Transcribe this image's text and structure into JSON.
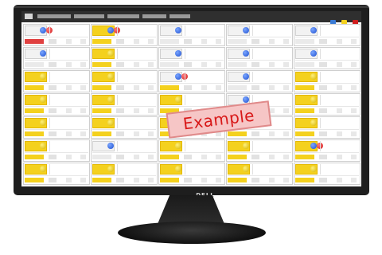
{
  "brand": {
    "label": "DELL"
  },
  "watermark": {
    "text": "Example"
  },
  "toolbar": {
    "legend_colors": [
      "#3a7bd5",
      "#f4d11e",
      "#d01e1e"
    ]
  },
  "tiles": [
    {
      "tag_yellow": false,
      "balls": [
        "blue",
        "red"
      ],
      "first_color": "r"
    },
    {
      "tag_yellow": true,
      "balls": [
        "blue",
        "red"
      ],
      "first_color": "y"
    },
    {
      "tag_yellow": false,
      "balls": [
        "blue"
      ],
      "first_color": ""
    },
    {
      "tag_yellow": false,
      "balls": [
        "blue"
      ],
      "first_color": ""
    },
    {
      "tag_yellow": false,
      "balls": [
        "blue"
      ],
      "first_color": ""
    },
    {
      "tag_yellow": false,
      "balls": [
        "blue"
      ],
      "first_color": ""
    },
    {
      "tag_yellow": true,
      "balls": [
        "yellow"
      ],
      "first_color": "y"
    },
    {
      "tag_yellow": false,
      "balls": [
        "blue"
      ],
      "first_color": ""
    },
    {
      "tag_yellow": false,
      "balls": [
        "blue"
      ],
      "first_color": ""
    },
    {
      "tag_yellow": false,
      "balls": [
        "blue"
      ],
      "first_color": ""
    },
    {
      "tag_yellow": true,
      "balls": [
        "yellow"
      ],
      "first_color": "y"
    },
    {
      "tag_yellow": true,
      "balls": [
        "yellow"
      ],
      "first_color": "y"
    },
    {
      "tag_yellow": false,
      "balls": [
        "blue",
        "red"
      ],
      "first_color": "y"
    },
    {
      "tag_yellow": false,
      "balls": [
        "blue"
      ],
      "first_color": ""
    },
    {
      "tag_yellow": true,
      "balls": [
        "yellow"
      ],
      "first_color": "y"
    },
    {
      "tag_yellow": true,
      "balls": [
        "yellow"
      ],
      "first_color": "y"
    },
    {
      "tag_yellow": true,
      "balls": [
        "yellow"
      ],
      "first_color": "y"
    },
    {
      "tag_yellow": true,
      "balls": [
        "yellow"
      ],
      "first_color": "y"
    },
    {
      "tag_yellow": false,
      "balls": [
        "blue"
      ],
      "first_color": ""
    },
    {
      "tag_yellow": true,
      "balls": [
        "yellow"
      ],
      "first_color": "y"
    },
    {
      "tag_yellow": true,
      "balls": [
        "yellow"
      ],
      "first_color": "y"
    },
    {
      "tag_yellow": true,
      "balls": [
        "yellow"
      ],
      "first_color": "y"
    },
    {
      "tag_yellow": true,
      "balls": [
        "yellow"
      ],
      "first_color": "y"
    },
    {
      "tag_yellow": true,
      "balls": [
        "yellow"
      ],
      "first_color": "y"
    },
    {
      "tag_yellow": true,
      "balls": [
        "yellow"
      ],
      "first_color": "y"
    },
    {
      "tag_yellow": true,
      "balls": [
        "yellow"
      ],
      "first_color": "y"
    },
    {
      "tag_yellow": false,
      "balls": [
        "blue"
      ],
      "first_color": ""
    },
    {
      "tag_yellow": true,
      "balls": [
        "yellow"
      ],
      "first_color": "y"
    },
    {
      "tag_yellow": true,
      "balls": [
        "yellow"
      ],
      "first_color": "y"
    },
    {
      "tag_yellow": true,
      "balls": [
        "blue",
        "red"
      ],
      "first_color": "y"
    },
    {
      "tag_yellow": true,
      "balls": [
        "yellow"
      ],
      "first_color": "y"
    },
    {
      "tag_yellow": true,
      "balls": [
        "yellow"
      ],
      "first_color": "y"
    },
    {
      "tag_yellow": true,
      "balls": [
        "yellow"
      ],
      "first_color": "y"
    },
    {
      "tag_yellow": true,
      "balls": [
        "yellow"
      ],
      "first_color": "y"
    },
    {
      "tag_yellow": true,
      "balls": [
        "yellow"
      ],
      "first_color": "y"
    }
  ]
}
